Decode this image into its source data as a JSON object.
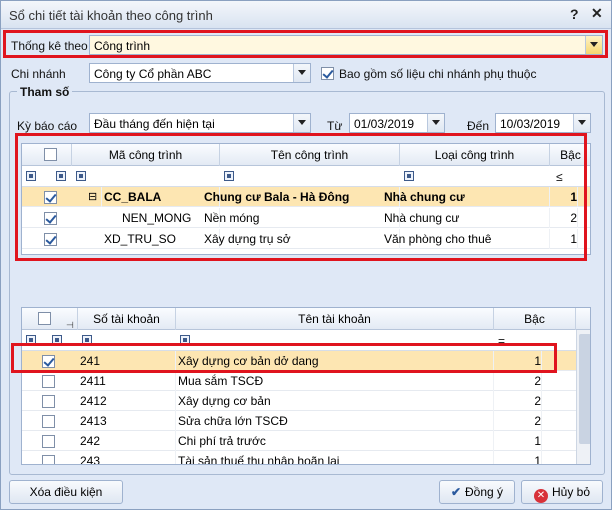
{
  "window": {
    "title": "Sổ chi tiết tài khoản theo công trình",
    "help": "?",
    "close": "✕"
  },
  "filter": {
    "statistic_label": "Thống kê theo",
    "statistic_value": "Công trình",
    "branch_label": "Chi nhánh",
    "branch_value": "Công ty Cổ phần ABC",
    "include_branch_label": "Bao gồm số liệu chi nhánh phụ thuộc",
    "include_branch_checked": true
  },
  "params": {
    "group_label": "Tham số",
    "period_label": "Kỳ báo cáo",
    "period_value": "Đầu tháng đến hiện tại",
    "from_label": "Từ",
    "from_value": "01/03/2019",
    "to_label": "Đến",
    "to_value": "10/03/2019"
  },
  "projects": {
    "columns": [
      "Mã công trình",
      "Tên công trình",
      "Loại công trình",
      "Bậc"
    ],
    "filter_op": "≤",
    "rows": [
      {
        "code": "CC_BALA",
        "name": "Chung cư Bala - Hà Đông",
        "type": "Nhà chung cư",
        "level": "1",
        "checked": true,
        "expander": "⊟"
      },
      {
        "code": "NEN_MONG",
        "name": "Nền móng",
        "type": "Nhà chung cư",
        "level": "2",
        "checked": true
      },
      {
        "code": "XD_TRU_SO",
        "name": "Xây dựng trụ sở",
        "type": "Văn phòng cho thuê",
        "level": "1",
        "checked": true
      }
    ]
  },
  "accounts": {
    "columns": [
      "Số tài khoản",
      "Tên tài khoản",
      "Bậc"
    ],
    "filter_op": "=",
    "rows": [
      {
        "no": "241",
        "name": "Xây dựng cơ bản dở dang",
        "level": "1",
        "checked": true
      },
      {
        "no": "2411",
        "name": "Mua sắm TSCĐ",
        "level": "2",
        "checked": false
      },
      {
        "no": "2412",
        "name": "Xây dựng cơ bản",
        "level": "2",
        "checked": false
      },
      {
        "no": "2413",
        "name": "Sửa chữa lớn TSCĐ",
        "level": "2",
        "checked": false
      },
      {
        "no": "242",
        "name": "Chi phí trả trước",
        "level": "1",
        "checked": false
      },
      {
        "no": "243",
        "name": "Tài sản thuế thu nhập hoãn lại",
        "level": "1",
        "checked": false
      }
    ]
  },
  "footer": {
    "clear_label": "Xóa điều kiện",
    "ok_label": "Đồng ý",
    "cancel_label": "Hủy bỏ"
  },
  "colors": {
    "highlight_row": "#fde6b2",
    "red_frame": "#e0141e",
    "accent": "#2b5a9e"
  }
}
